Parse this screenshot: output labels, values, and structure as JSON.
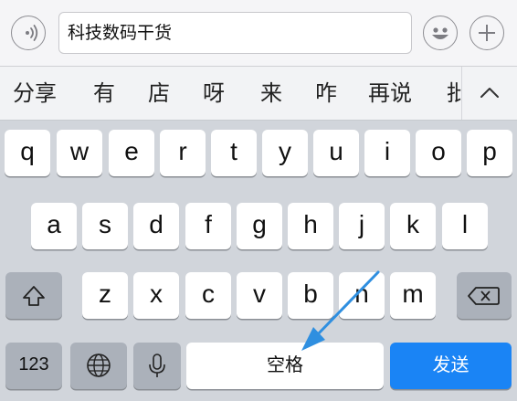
{
  "input_bar": {
    "voice_icon": "voice-icon",
    "text": "科技数码干货",
    "emoji_icon": "emoji-icon",
    "plus_icon": "plus-icon"
  },
  "candidates": [
    "分享",
    "有",
    "店",
    "呀",
    "来",
    "咋",
    "再说",
    "批"
  ],
  "candidate_expand_icon": "chevron-up-icon",
  "keyboard": {
    "row1": [
      "q",
      "w",
      "e",
      "r",
      "t",
      "y",
      "u",
      "i",
      "o",
      "p"
    ],
    "row2": [
      "a",
      "s",
      "d",
      "f",
      "g",
      "h",
      "j",
      "k",
      "l"
    ],
    "row3": [
      "z",
      "x",
      "c",
      "v",
      "b",
      "n",
      "m"
    ],
    "shift_icon": "shift-icon",
    "delete_icon": "backspace-icon",
    "numbers_label": "123",
    "globe_icon": "globe-icon",
    "mic_icon": "microphone-icon",
    "space_label": "空格",
    "send_label": "发送",
    "send_color": "#1a84f5"
  },
  "annotation": {
    "arrow_color": "#2f8fe0"
  }
}
